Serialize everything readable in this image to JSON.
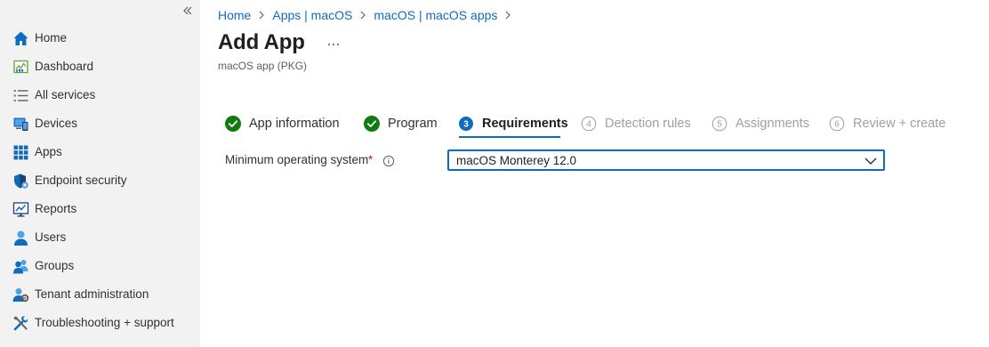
{
  "sidebar": {
    "collapse_icon": "double-chevron-left-icon",
    "items": [
      {
        "label": "Home",
        "icon": "home-icon"
      },
      {
        "label": "Dashboard",
        "icon": "dashboard-icon"
      },
      {
        "label": "All services",
        "icon": "list-icon"
      },
      {
        "label": "Devices",
        "icon": "devices-icon"
      },
      {
        "label": "Apps",
        "icon": "apps-grid-icon"
      },
      {
        "label": "Endpoint security",
        "icon": "shield-icon"
      },
      {
        "label": "Reports",
        "icon": "reports-icon"
      },
      {
        "label": "Users",
        "icon": "user-icon"
      },
      {
        "label": "Groups",
        "icon": "groups-icon"
      },
      {
        "label": "Tenant administration",
        "icon": "tenant-admin-icon"
      },
      {
        "label": "Troubleshooting + support",
        "icon": "tools-icon"
      }
    ]
  },
  "breadcrumb": [
    "Home",
    "Apps | macOS",
    "macOS | macOS apps"
  ],
  "page": {
    "title": "Add App",
    "more_label": "···",
    "subtitle": "macOS app (PKG)"
  },
  "wizard": {
    "steps": [
      {
        "label": "App information",
        "state": "done"
      },
      {
        "label": "Program",
        "state": "done"
      },
      {
        "number": "3",
        "label": "Requirements",
        "state": "active"
      },
      {
        "number": "4",
        "label": "Detection rules",
        "state": "pending"
      },
      {
        "number": "5",
        "label": "Assignments",
        "state": "pending"
      },
      {
        "number": "6",
        "label": "Review + create",
        "state": "pending"
      }
    ]
  },
  "form": {
    "min_os_label": "Minimum operating system",
    "required_marker": "*",
    "min_os_value": "macOS Monterey 12.0"
  },
  "colors": {
    "accent": "#0f6cbd",
    "success": "#107c10",
    "sidebar_bg": "#f2f2f2",
    "required": "#a4262c"
  }
}
